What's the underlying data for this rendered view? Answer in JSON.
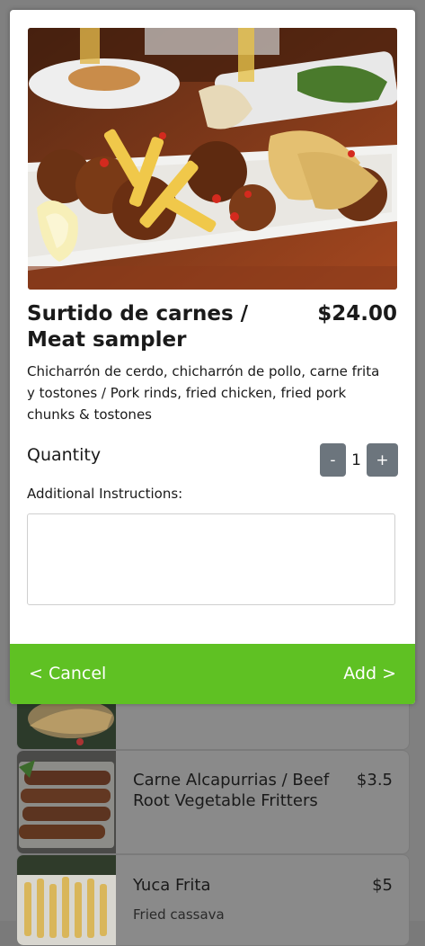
{
  "modal": {
    "title": "Surtido de carnes / Meat sampler",
    "price": "$24.00",
    "description": "Chicharrón de cerdo, chicharrón de pollo, carne frita y tostones / Pork rinds, fried chicken, fried pork chunks & tostones",
    "image_icon": "food-photo-meat-sampler",
    "quantity_label": "Quantity",
    "quantity_value": "1",
    "minus_label": "-",
    "plus_label": "+",
    "instructions_label": "Additional Instructions:",
    "instructions_value": "",
    "cancel_label": "< Cancel",
    "add_label": "Add >",
    "accent_color": "#5fc123",
    "stepper_color": "#6c757d"
  },
  "menu_items": [
    {
      "name": "",
      "price": "",
      "description": "",
      "image_icon": "food-photo-empanada"
    },
    {
      "name": "Carne Alcapurrias / Beef Root Vegetable Fritters",
      "price": "$3.5",
      "description": "",
      "image_icon": "food-photo-alcapurrias"
    },
    {
      "name": "Yuca Frita",
      "price": "$5",
      "description": "Fried cassava",
      "image_icon": "food-photo-fried-yuca"
    }
  ]
}
